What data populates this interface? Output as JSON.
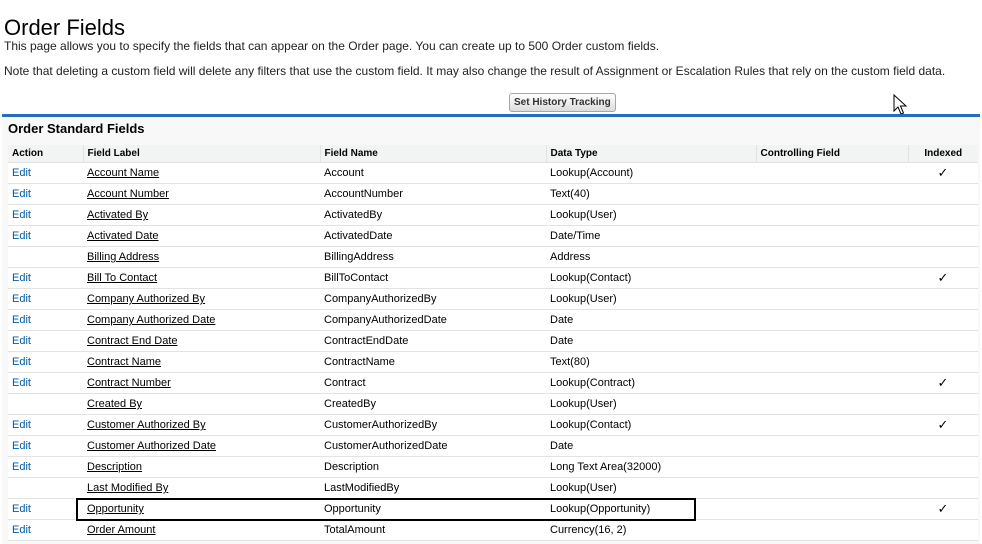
{
  "page": {
    "title": "Order Fields",
    "description_1": "This page allows you to specify the fields that can appear on the Order page. You can create up to 500 Order custom fields.",
    "description_2": "Note that deleting a custom field will delete any filters that use the custom field. It may also change the result of Assignment or Escalation Rules that rely on the custom field data."
  },
  "toolbar": {
    "history_button": "Set History Tracking"
  },
  "section": {
    "title": "Order Standard Fields",
    "columns": [
      "Action",
      "Field Label",
      "Field Name",
      "Data Type",
      "Controlling Field",
      "Indexed"
    ],
    "rows": [
      {
        "action": "Edit",
        "label": "Account Name",
        "name": "Account",
        "type": "Lookup(Account)",
        "controlling": "",
        "indexed": "✓"
      },
      {
        "action": "Edit",
        "label": "Account Number",
        "name": "AccountNumber",
        "type": "Text(40)",
        "controlling": "",
        "indexed": ""
      },
      {
        "action": "Edit",
        "label": "Activated By",
        "name": "ActivatedBy",
        "type": "Lookup(User)",
        "controlling": "",
        "indexed": ""
      },
      {
        "action": "Edit",
        "label": "Activated Date",
        "name": "ActivatedDate",
        "type": "Date/Time",
        "controlling": "",
        "indexed": ""
      },
      {
        "action": "",
        "label": "Billing Address",
        "name": "BillingAddress",
        "type": "Address",
        "controlling": "",
        "indexed": ""
      },
      {
        "action": "Edit",
        "label": "Bill To Contact",
        "name": "BillToContact",
        "type": "Lookup(Contact)",
        "controlling": "",
        "indexed": "✓"
      },
      {
        "action": "Edit",
        "label": "Company Authorized By",
        "name": "CompanyAuthorizedBy",
        "type": "Lookup(User)",
        "controlling": "",
        "indexed": ""
      },
      {
        "action": "Edit",
        "label": "Company Authorized Date",
        "name": "CompanyAuthorizedDate",
        "type": "Date",
        "controlling": "",
        "indexed": ""
      },
      {
        "action": "Edit",
        "label": "Contract End Date",
        "name": "ContractEndDate",
        "type": "Date",
        "controlling": "",
        "indexed": ""
      },
      {
        "action": "Edit",
        "label": "Contract Name",
        "name": "ContractName",
        "type": "Text(80)",
        "controlling": "",
        "indexed": ""
      },
      {
        "action": "Edit",
        "label": "Contract Number",
        "name": "Contract",
        "type": "Lookup(Contract)",
        "controlling": "",
        "indexed": "✓"
      },
      {
        "action": "",
        "label": "Created By",
        "name": "CreatedBy",
        "type": "Lookup(User)",
        "controlling": "",
        "indexed": ""
      },
      {
        "action": "Edit",
        "label": "Customer Authorized By",
        "name": "CustomerAuthorizedBy",
        "type": "Lookup(Contact)",
        "controlling": "",
        "indexed": "✓"
      },
      {
        "action": "Edit",
        "label": "Customer Authorized Date",
        "name": "CustomerAuthorizedDate",
        "type": "Date",
        "controlling": "",
        "indexed": ""
      },
      {
        "action": "Edit",
        "label": "Description",
        "name": "Description",
        "type": "Long Text Area(32000)",
        "controlling": "",
        "indexed": ""
      },
      {
        "action": "",
        "label": "Last Modified By",
        "name": "LastModifiedBy",
        "type": "Lookup(User)",
        "controlling": "",
        "indexed": ""
      },
      {
        "action": "Edit",
        "label": "Opportunity",
        "name": "Opportunity",
        "type": "Lookup(Opportunity)",
        "controlling": "",
        "indexed": "✓"
      },
      {
        "action": "Edit",
        "label": "Order Amount",
        "name": "TotalAmount",
        "type": "Currency(16, 2)",
        "controlling": "",
        "indexed": ""
      }
    ]
  },
  "colors": {
    "accent": "#236fbd",
    "link": "#015ba7",
    "header_bg": "#f2f3f3"
  },
  "icons": {
    "cursor": "mouse-pointer-icon",
    "check": "checkmark-icon"
  }
}
